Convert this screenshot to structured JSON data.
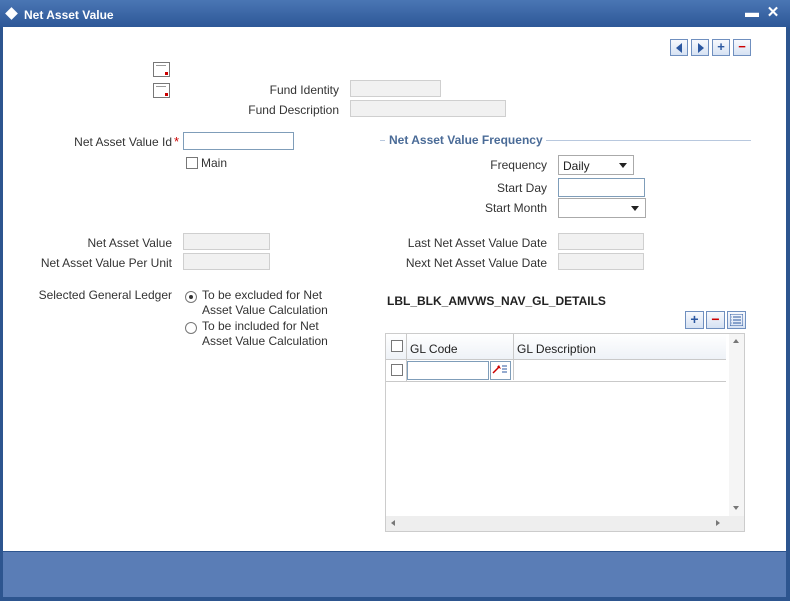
{
  "window": {
    "title": "Net Asset Value",
    "minimize_label": "▬",
    "close_label": "✕"
  },
  "toolbar": {
    "add_label": "+",
    "delete_label": "−"
  },
  "fund": {
    "identity_label": "Fund Identity",
    "description_label": "Fund Description"
  },
  "nav_id": {
    "label": "Net Asset Value Id",
    "required_mark": "*",
    "value": ""
  },
  "main": {
    "label": "Main",
    "checked": false
  },
  "frequency_section": {
    "title": "Net Asset Value Frequency",
    "frequency_label": "Frequency",
    "frequency_value": "Daily",
    "start_day_label": "Start Day",
    "start_month_label": "Start Month",
    "start_month_value": ""
  },
  "values": {
    "nav_label": "Net Asset Value",
    "nav_per_unit_label": "Net Asset Value Per Unit",
    "last_nav_date_label": "Last Net Asset Value Date",
    "next_nav_date_label": "Next Net Asset Value Date"
  },
  "gl": {
    "label": "Selected General Ledger",
    "options": [
      {
        "line1": "To be excluded for Net",
        "line2": "Asset Value Calculation",
        "selected": true
      },
      {
        "line1": "To be included for Net",
        "line2": "Asset Value Calculation",
        "selected": false
      }
    ]
  },
  "gl_details": {
    "title": "LBL_BLK_AMVWS_NAV_GL_DETAILS",
    "add_label": "+",
    "delete_label": "−",
    "columns": [
      "GL Code",
      "GL Description"
    ],
    "rows": [
      {
        "gl_code": "",
        "gl_description": ""
      }
    ]
  },
  "colors": {
    "titlebar": "#2c5696",
    "section_title": "#4a6b97",
    "required": "#cc0000"
  }
}
